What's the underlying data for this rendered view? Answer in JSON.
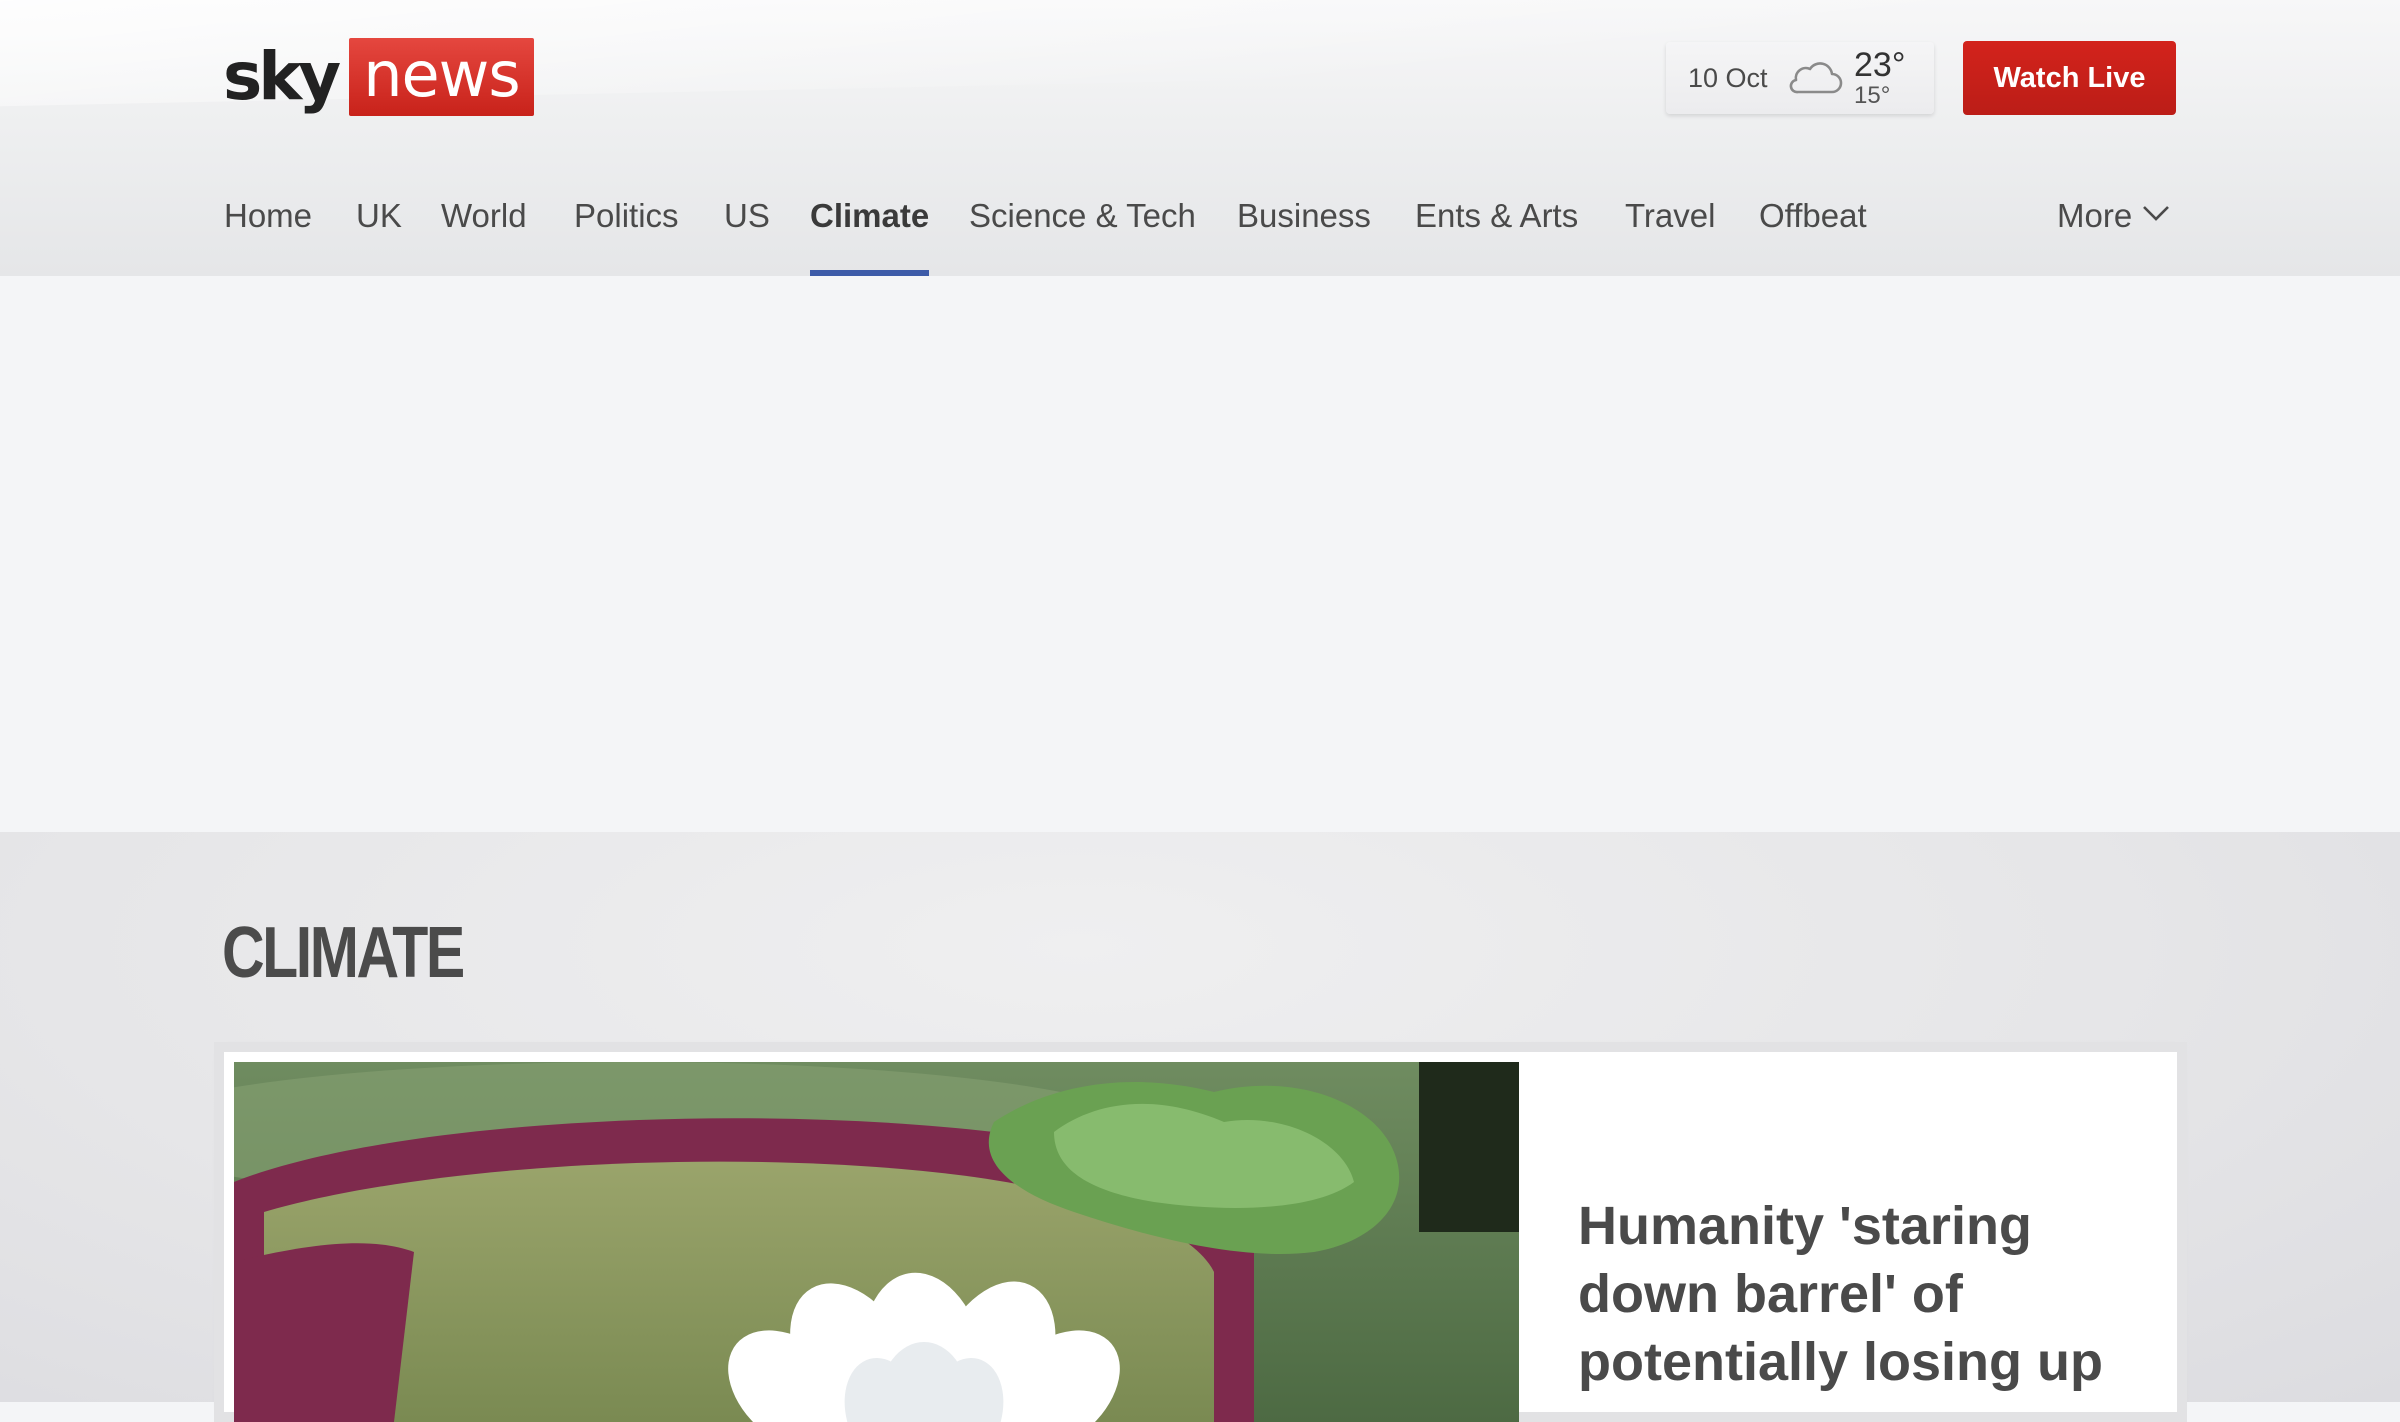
{
  "header": {
    "logo": {
      "sky": "sky",
      "news": "news"
    },
    "weather": {
      "date": "10 Oct",
      "icon": "cloud-icon",
      "high": "23°",
      "low": "15°"
    },
    "watch_live": "Watch Live"
  },
  "nav": {
    "items": [
      {
        "label": "Home"
      },
      {
        "label": "UK"
      },
      {
        "label": "World"
      },
      {
        "label": "Politics"
      },
      {
        "label": "US"
      },
      {
        "label": "Climate",
        "active": true
      },
      {
        "label": "Science & Tech"
      },
      {
        "label": "Business"
      },
      {
        "label": "Ents & Arts"
      },
      {
        "label": "Travel"
      },
      {
        "label": "Offbeat"
      }
    ],
    "more": "More"
  },
  "section": {
    "title": "CLIMATE"
  },
  "lead_story": {
    "headline": "Humanity 'staring down barrel' of potentially losing up",
    "image": "water-lily-photo"
  },
  "colors": {
    "brand_red": "#c8221a",
    "active_underline": "#3d5ba8"
  }
}
